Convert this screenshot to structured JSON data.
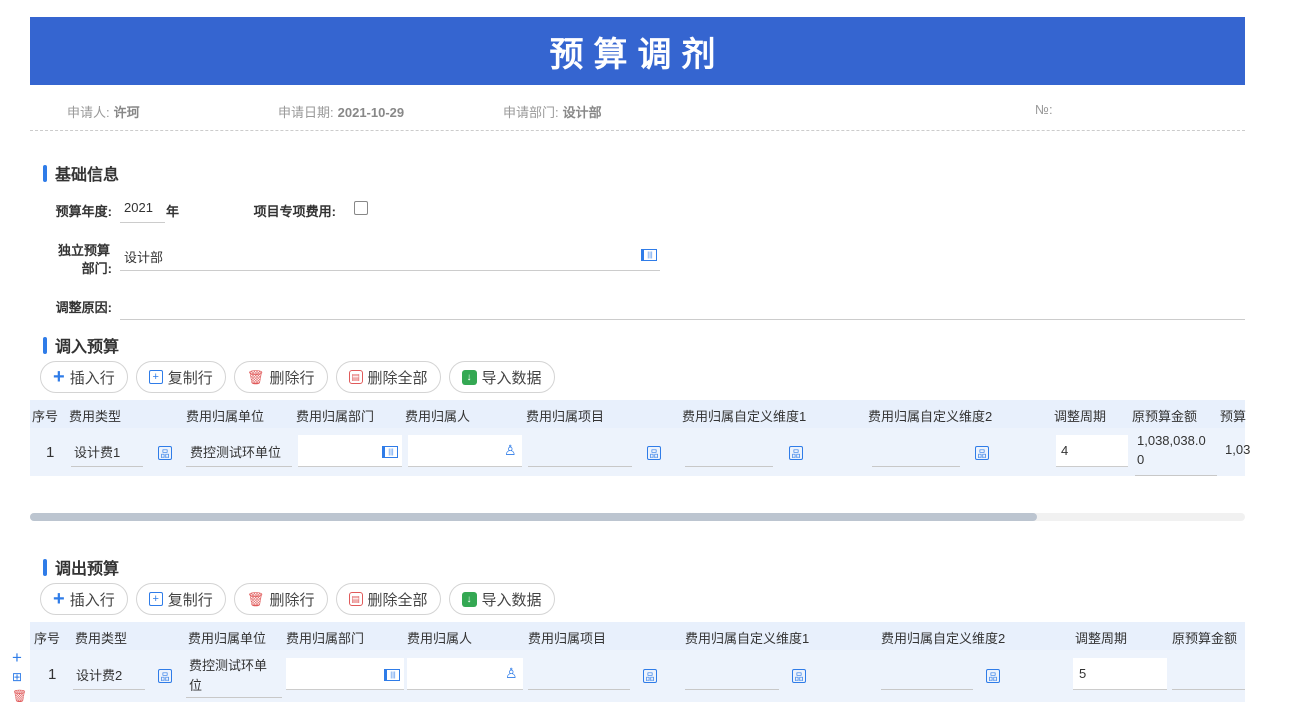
{
  "title": "预算调剂",
  "meta": {
    "applicant_label": "申请人:",
    "applicant": "许珂",
    "date_label": "申请日期:",
    "date": "2021-10-29",
    "dept_label": "申请部门:",
    "dept": "设计部",
    "no_label": "№:"
  },
  "basic": {
    "title": "基础信息",
    "year_label": "预算年度:",
    "year": "2021",
    "year_unit": "年",
    "project_label": "项目专项费用:",
    "indep_dept_label_1": "独立预算",
    "indep_dept_label_2": "部门:",
    "indep_dept": "设计部",
    "reason_label": "调整原因:"
  },
  "toolbar": {
    "insert": "插入行",
    "copy": "复制行",
    "delete": "删除行",
    "delete_all": "删除全部",
    "import": "导入数据"
  },
  "in_budget": {
    "title": "调入预算",
    "headers": [
      "序号",
      "费用类型",
      "费用归属单位",
      "费用归属部门",
      "费用归属人",
      "费用归属项目",
      "费用归属自定义维度1",
      "费用归属自定义维度2",
      "调整周期",
      "原预算金额",
      "预算"
    ],
    "row": {
      "no": "1",
      "type": "设计费1",
      "unit": "费控测试环单位",
      "period": "4",
      "orig_amount_1": "1,038,038.0",
      "orig_amount_2": "0",
      "budget": "1,03"
    }
  },
  "out_budget": {
    "title": "调出预算",
    "headers": [
      "序号",
      "费用类型",
      "费用归属单位",
      "费用归属部门",
      "费用归属人",
      "费用归属项目",
      "费用归属自定义维度1",
      "费用归属自定义维度2",
      "调整周期",
      "原预算金额"
    ],
    "row": {
      "no": "1",
      "type": "设计费2",
      "unit_1": "费控测试环单",
      "unit_2": "位",
      "period": "5"
    }
  },
  "colors": {
    "banner": "#3565d0",
    "accent": "#2f7ce8",
    "danger": "#e05a5a",
    "table_bg": "#edf3fc"
  }
}
